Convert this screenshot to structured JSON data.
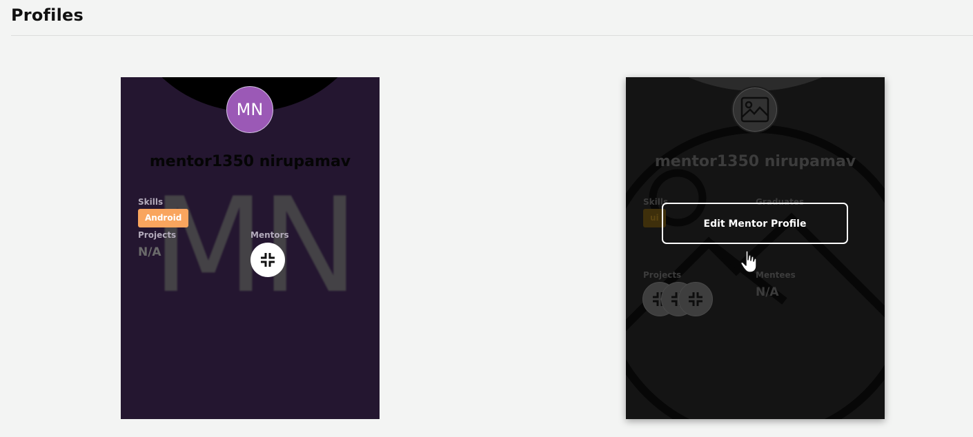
{
  "header": {
    "title": "Profiles"
  },
  "cards": [
    {
      "initials": "MN",
      "background_letters": "MN",
      "name": "mentor1350 nirupamav",
      "skills_label": "Skills",
      "skills": [
        "Android"
      ],
      "projects_label": "Projects",
      "projects_value": "N/A",
      "mentors_label": "Mentors",
      "colors": {
        "card": "#241630",
        "avatar": "#9b59b6",
        "skill_chip": "#f9a55e"
      }
    },
    {
      "avatar_icon": "image-placeholder-icon",
      "name": "mentor1350 nirupamav",
      "skills_label": "Skills",
      "skills": [
        "ui"
      ],
      "graduates_label": "Graduates",
      "projects_label": "Projects",
      "mentees_label": "Mentees",
      "mentees_value": "N/A",
      "overlay_button": "Edit Mentor Profile",
      "colors": {
        "card": "#141414",
        "button_border": "#ffffff"
      }
    }
  ]
}
